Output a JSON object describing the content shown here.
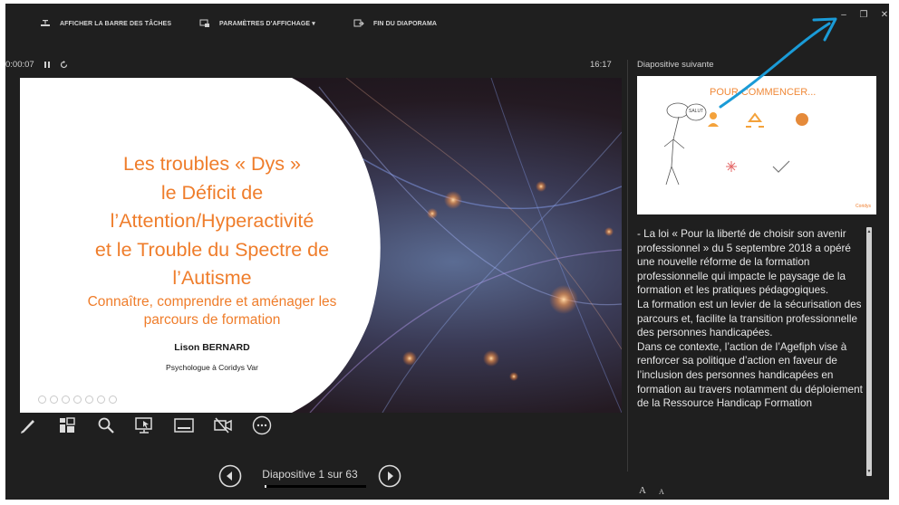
{
  "toolbar": {
    "show_taskbar": "AFFICHER LA BARRE DES TÂCHES",
    "display_settings": "PARAMÈTRES D'AFFICHAGE ▾",
    "end_slideshow": "FIN DU DIAPORAMA"
  },
  "window_controls": {
    "minimize": "–",
    "restore": "❐",
    "close": "✕"
  },
  "timer": {
    "elapsed": "0:00:07",
    "pause_icon": "pause-icon",
    "reset_icon": "reset-icon"
  },
  "clock": "16:17",
  "slide": {
    "title_lines": [
      "Les troubles « Dys »",
      "le Déficit de",
      "l’Attention/Hyperactivité",
      "et le Trouble du Spectre de",
      "l’Autisme"
    ],
    "subtitle_lines": [
      "Connaître, comprendre et aménager les",
      "parcours de formation"
    ],
    "author": "Lison BERNARD",
    "affiliation": "Psychologue à Coridys Var",
    "title_color": "#EF7D2B"
  },
  "tools": [
    {
      "name": "pen-tool-icon"
    },
    {
      "name": "see-all-slides-icon"
    },
    {
      "name": "zoom-icon"
    },
    {
      "name": "pointer-options-icon"
    },
    {
      "name": "subtitles-icon"
    },
    {
      "name": "camera-off-icon"
    },
    {
      "name": "more-options-icon"
    }
  ],
  "navigation": {
    "counter": "Diapositive 1 sur 63",
    "progress_fraction": 0.016
  },
  "next_slide": {
    "label": "Diapositive suivante",
    "thumb_title": "POUR COMMENCER...",
    "bubble": "SALUT",
    "brand": "Coridys"
  },
  "notes": [
    "- La loi « Pour la liberté de choisir son avenir professionnel » du 5 septembre 2018 a opéré une nouvelle réforme de la formation professionnelle qui impacte le paysage de la formation et les pratiques pédagogiques.",
    "La formation est un levier de la sécurisation des parcours et, facilite la transition professionnelle des personnes handicapées.",
    "Dans ce contexte, l’action de l’Agefiph vise à renforcer sa politique d’action en faveur de l’inclusion des personnes handicapées en formation au travers notamment du déploiement de la Ressource Handicap Formation"
  ],
  "font_buttons": {
    "increase": "A",
    "decrease": "A"
  },
  "annotation_color": "#1A9BD7"
}
